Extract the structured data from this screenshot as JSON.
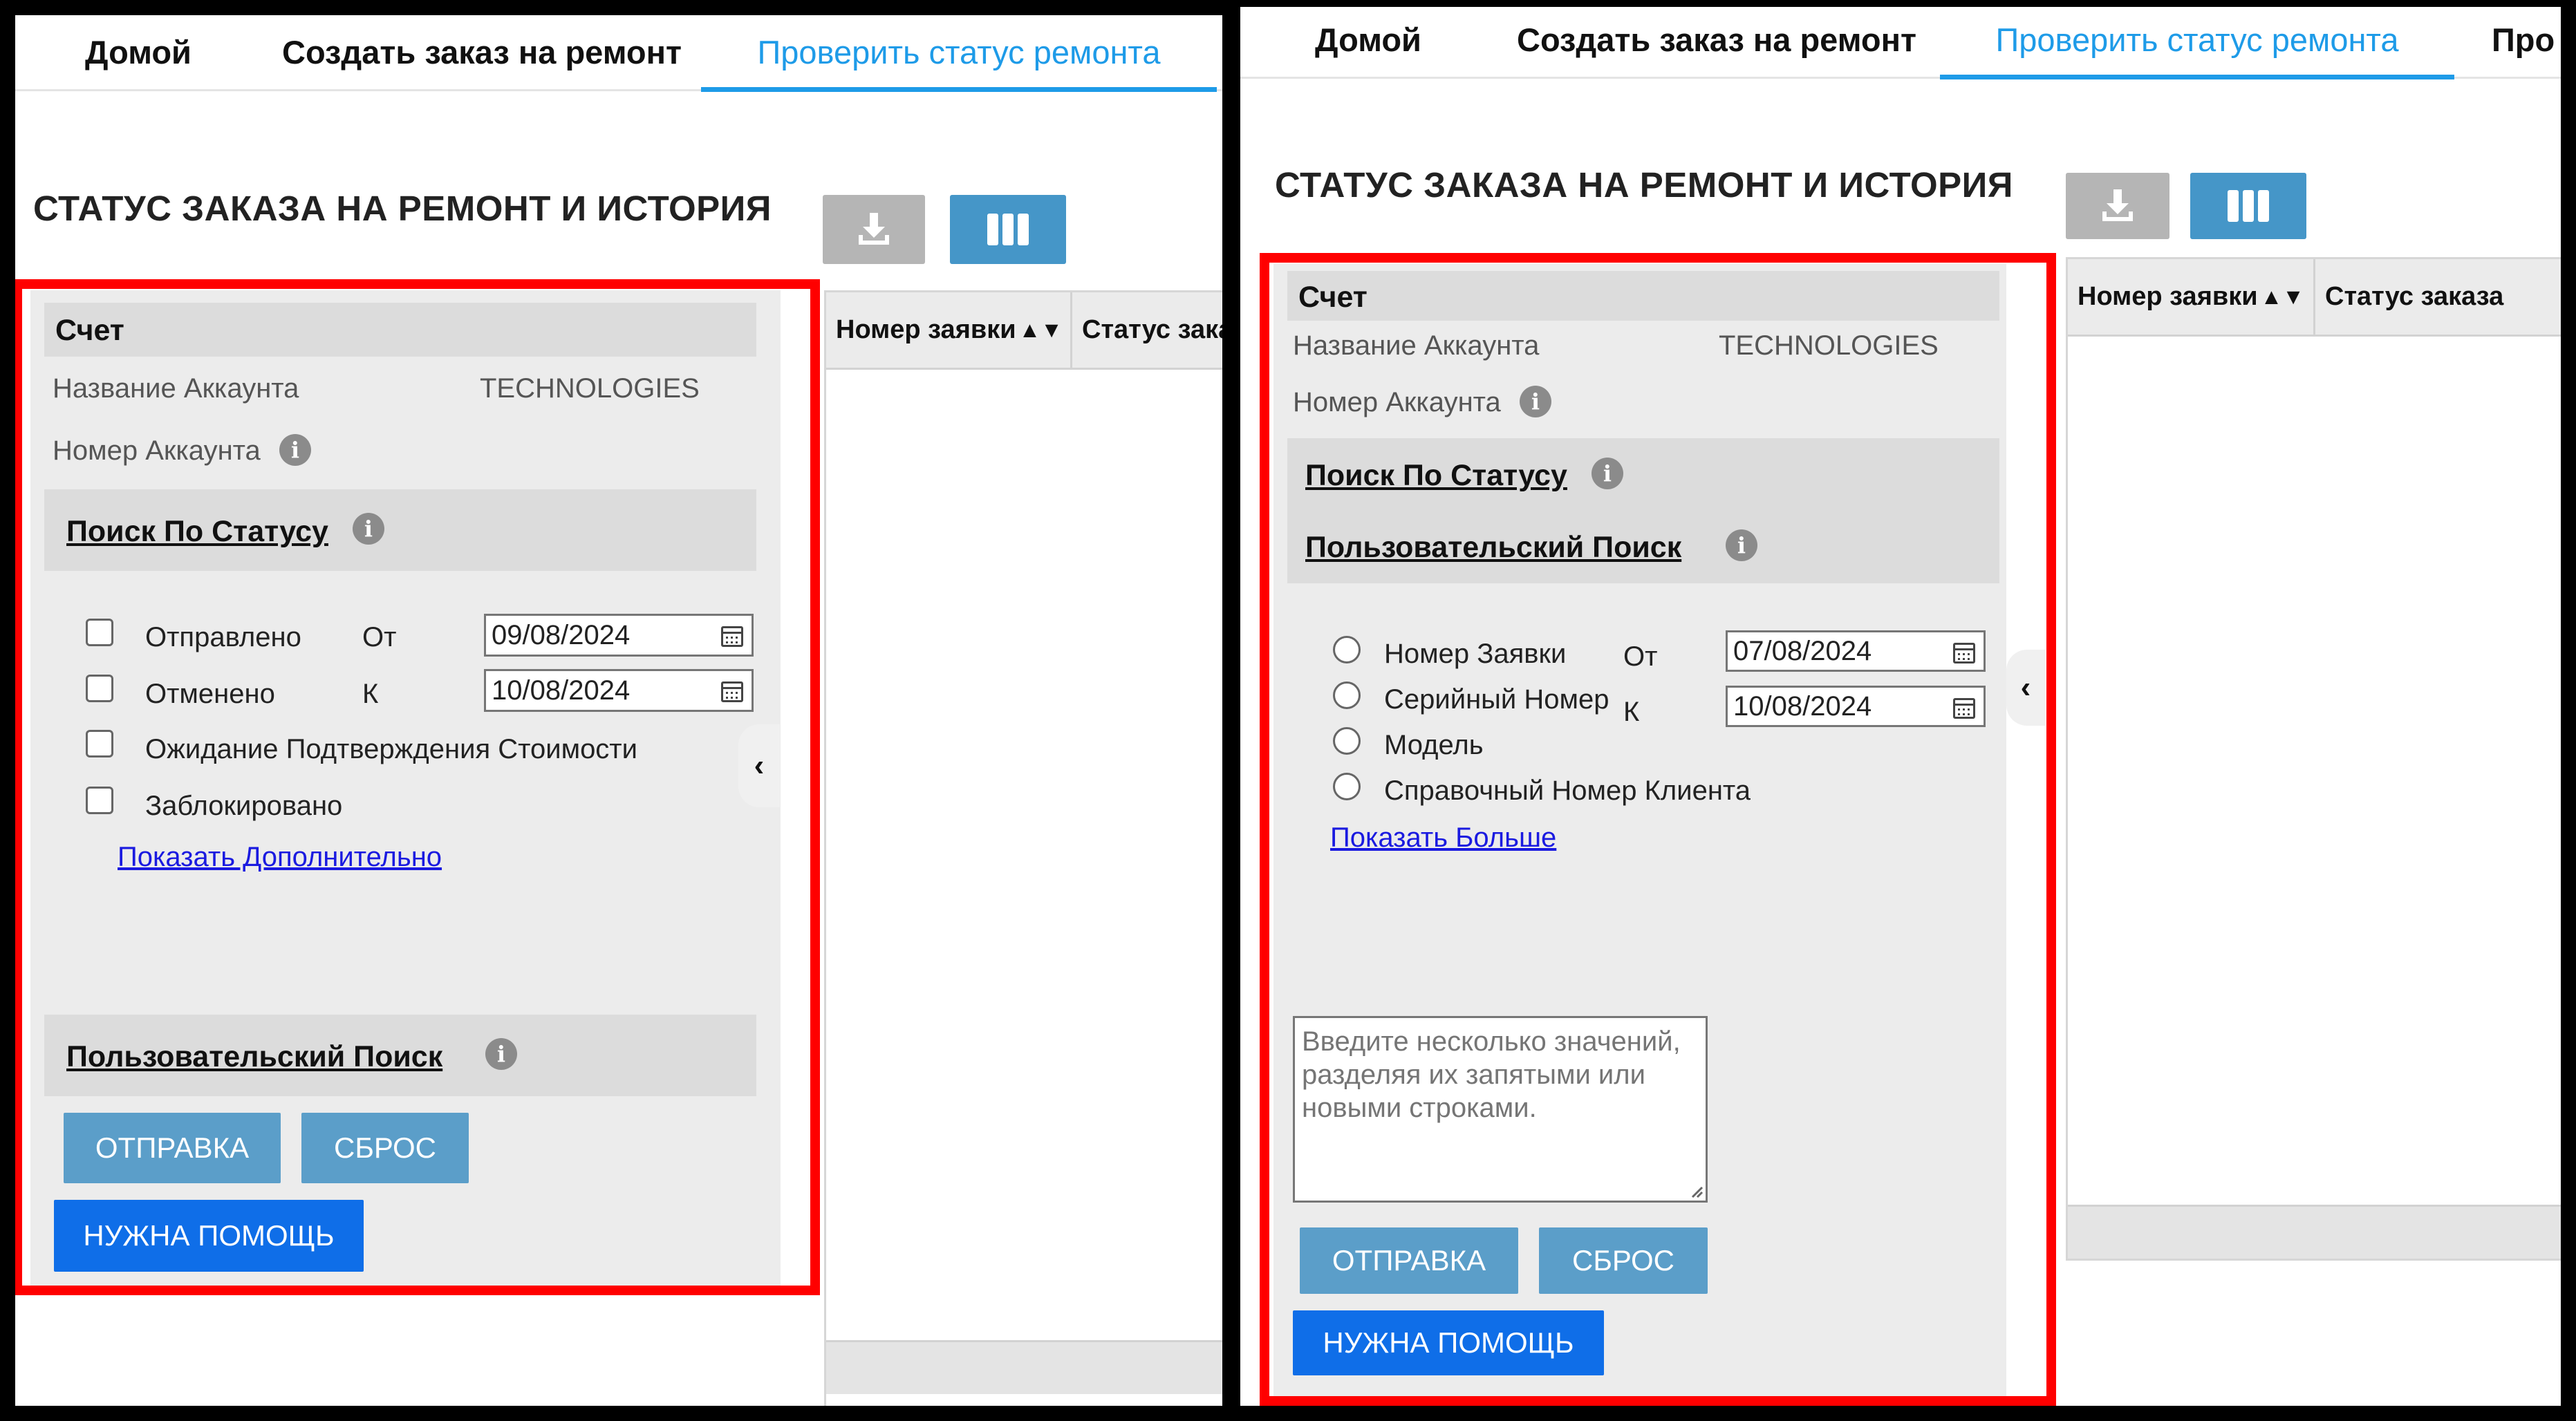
{
  "left": {
    "nav": {
      "tabs": [
        "Домой",
        "Создать заказ на ремонт",
        "Проверить статус ремонта"
      ]
    },
    "title": "СТАТУС ЗАКАЗА НА РЕМОНТ И ИСТОРИЯ",
    "toolbar": {
      "download_icon": "download-icon",
      "columns_icon": "columns-icon"
    },
    "grid": {
      "columns": [
        "Номер заявки",
        "Статус зака"
      ],
      "sort_glyph": "▲▼"
    },
    "account": {
      "section": "Счет",
      "name_label": "Название Аккаунта",
      "name_value": "TECHNOLOGIES",
      "number_label": "Номер Аккаунта"
    },
    "status_search": {
      "label": "Поиск По Статусу",
      "items": [
        "Отправлено",
        "Отменено",
        "Ожидание Подтверждения Стоимости",
        "Заблокировано"
      ],
      "from_label": "От",
      "to_label": "К",
      "from_date": "09/08/2024",
      "to_date": "10/08/2024",
      "more_link": "Показать Дополнительно"
    },
    "custom_search": {
      "label": "Пользовательский Поиск"
    },
    "buttons": {
      "submit": "ОТПРАВКА",
      "reset": "СБРОС",
      "help": "НУЖНА ПОМОЩЬ"
    }
  },
  "right": {
    "nav": {
      "tabs": [
        "Домой",
        "Создать заказ на ремонт",
        "Проверить статус ремонта",
        "Про"
      ]
    },
    "title": "СТАТУС ЗАКАЗА НА РЕМОНТ И ИСТОРИЯ",
    "grid": {
      "columns": [
        "Номер заявки",
        "Статус заказа"
      ],
      "sort_glyph": "▲▼"
    },
    "account": {
      "section": "Счет",
      "name_label": "Название Аккаунта",
      "name_value": "TECHNOLOGIES",
      "number_label": "Номер Аккаунта"
    },
    "status_search": {
      "label": "Поиск По Статусу"
    },
    "custom_search": {
      "label": "Пользовательский Поиск",
      "options": [
        "Номер Заявки",
        "Серийный Номер",
        "Модель",
        "Справочный Номер Клиента"
      ],
      "from_label": "От",
      "to_label": "К",
      "from_date": "07/08/2024",
      "to_date": "10/08/2024",
      "more_link": "Показать Больше",
      "textarea_placeholder": "Введите несколько значений, разделяя их запятыми или новыми строками."
    },
    "buttons": {
      "submit": "ОТПРАВКА",
      "reset": "СБРОС",
      "help": "НУЖНА ПОМОЩЬ"
    }
  },
  "colors": {
    "accent": "#1e9be8",
    "highlight_border": "#ff0000",
    "primary_button": "#0f6ee8",
    "secondary_button": "#5b9ec9"
  }
}
